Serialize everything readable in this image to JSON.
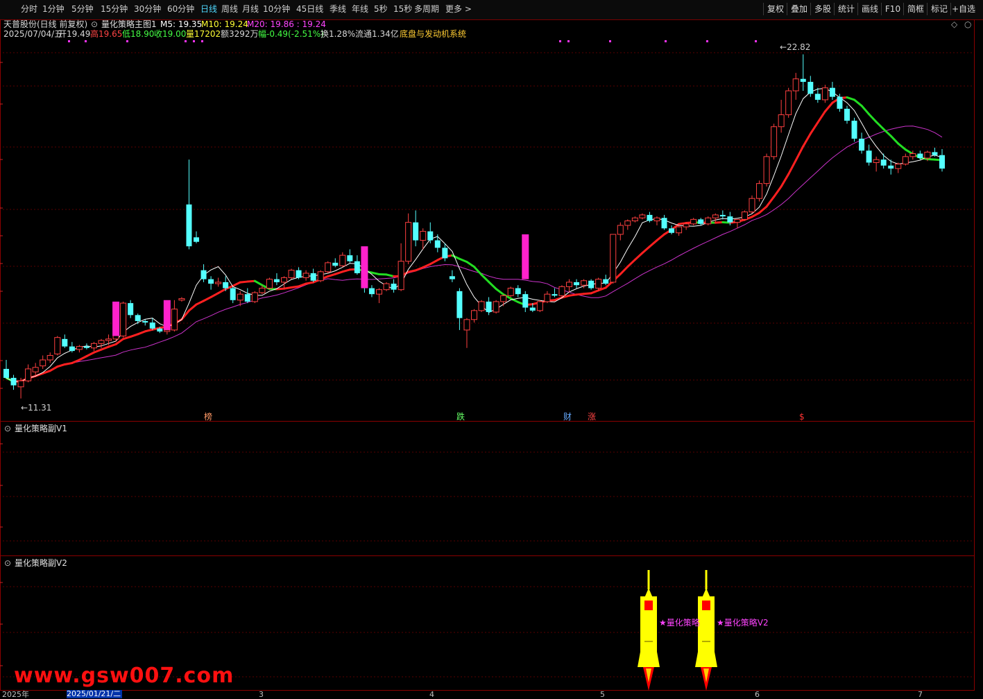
{
  "toolbar": {
    "periods": [
      "分时",
      "1分钟",
      "5分钟",
      "15分钟",
      "30分钟",
      "60分钟",
      "日线",
      "周线",
      "月线",
      "10分钟",
      "45日线",
      "季线",
      "年线",
      "5秒",
      "15秒",
      "多周期",
      "更多 >"
    ],
    "active_period": "日线",
    "buttons": [
      "复权",
      "叠加",
      "多股",
      "统计",
      "画线",
      "F10",
      "简框",
      "标记",
      "+自选"
    ]
  },
  "header": {
    "stock_name": "天普股份(日线 前复权)",
    "indicator_name": "量化策略主图1",
    "m5_label": "M5: 19.35",
    "m10_label": "M10: 19.24",
    "m20_label": "M20: 19.86 : 19.24",
    "date": "2025/07/04/五",
    "open": "开19.49",
    "high": "高19.65",
    "low": "低18.90",
    "close": "收19.00",
    "volume": "量17202",
    "amount": "额3292万",
    "change": "幅-0.49(-2.51%)",
    "turnover": "换1.28%",
    "float_cap": "流通1.34亿",
    "system_name": "底盘与发动机系统"
  },
  "price_annotations": {
    "high": "22.82",
    "low": "11.31"
  },
  "event_markers": [
    {
      "label": "榜",
      "color": "#ff9966"
    },
    {
      "label": "跌",
      "color": "#66ff66"
    },
    {
      "label": "财",
      "color": "#66aaff"
    },
    {
      "label": "涨",
      "color": "#ff4444"
    },
    {
      "label": "$",
      "color": "#ff3333"
    }
  ],
  "sub_panels": {
    "v1_title": "量化策略副V1",
    "v2_title": "量化策略副V2",
    "v2_signal_1": "★量化策略",
    "v2_signal_2": "★量化策略V2"
  },
  "date_axis": {
    "year_label": "2025年",
    "selected_date": "2025/01/21/二",
    "months": [
      "3",
      "4",
      "5",
      "6",
      "7"
    ]
  },
  "watermark": "www.gsw007.com",
  "colors": {
    "up": "#ff4040",
    "down": "#54ffff",
    "ma_red": "#ff2020",
    "ma_green": "#22dd22",
    "ma_white": "#ffffff",
    "ma_purple": "#cc33cc",
    "magenta_bar": "#ff22cc",
    "panel_border": "#8b0000",
    "signal_yellow": "#ffff00"
  },
  "chart_data": {
    "type": "candlestick",
    "ylim": [
      11.0,
      23.2
    ],
    "candles": [
      [
        12.3,
        12.6,
        12.0,
        12.0
      ],
      [
        12.0,
        12.1,
        11.6,
        11.75
      ],
      [
        11.7,
        12.0,
        11.31,
        11.9
      ],
      [
        11.9,
        12.45,
        11.85,
        12.3
      ],
      [
        12.2,
        12.5,
        12.1,
        12.35
      ],
      [
        12.4,
        12.75,
        12.3,
        12.6
      ],
      [
        12.6,
        12.85,
        12.5,
        12.75
      ],
      [
        12.8,
        13.4,
        12.75,
        13.35
      ],
      [
        13.3,
        13.45,
        13.0,
        13.05
      ],
      [
        13.05,
        13.2,
        12.85,
        12.9
      ],
      [
        12.95,
        13.1,
        12.85,
        13.05
      ],
      [
        13.05,
        13.15,
        12.95,
        13.0
      ],
      [
        13.0,
        13.2,
        12.9,
        13.15
      ],
      [
        13.15,
        13.3,
        13.0,
        13.25
      ],
      [
        13.25,
        13.45,
        13.1,
        13.3
      ],
      [
        13.3,
        13.55,
        13.2,
        13.45
      ],
      [
        13.4,
        14.55,
        13.35,
        14.5
      ],
      [
        14.5,
        14.6,
        14.0,
        14.1
      ],
      [
        14.1,
        14.15,
        13.8,
        13.9
      ],
      [
        13.9,
        13.95,
        13.75,
        13.85
      ],
      [
        13.85,
        14.0,
        13.6,
        13.65
      ],
      [
        13.65,
        13.7,
        13.5,
        13.55
      ],
      [
        13.55,
        13.7,
        13.45,
        13.6
      ],
      [
        13.6,
        14.6,
        13.55,
        14.3
      ],
      [
        14.6,
        14.7,
        14.55,
        14.65
      ],
      [
        17.8,
        19.3,
        16.3,
        16.4
      ],
      [
        16.7,
        16.9,
        16.5,
        16.55
      ],
      [
        15.6,
        15.8,
        15.2,
        15.3
      ],
      [
        15.3,
        15.4,
        14.95,
        15.15
      ],
      [
        15.15,
        15.35,
        15.05,
        15.2
      ],
      [
        15.2,
        15.4,
        14.9,
        15.0
      ],
      [
        15.0,
        15.05,
        14.5,
        14.6
      ],
      [
        14.6,
        14.9,
        14.4,
        14.8
      ],
      [
        14.8,
        15.0,
        14.5,
        14.55
      ],
      [
        14.55,
        14.9,
        14.5,
        14.85
      ],
      [
        14.85,
        15.1,
        14.8,
        15.0
      ],
      [
        15.0,
        15.35,
        14.95,
        15.3
      ],
      [
        15.3,
        15.5,
        15.1,
        15.2
      ],
      [
        15.2,
        15.4,
        15.0,
        15.35
      ],
      [
        15.35,
        15.65,
        15.3,
        15.6
      ],
      [
        15.6,
        15.7,
        15.3,
        15.35
      ],
      [
        15.35,
        15.6,
        15.25,
        15.5
      ],
      [
        15.5,
        15.65,
        15.2,
        15.25
      ],
      [
        15.25,
        15.6,
        15.2,
        15.55
      ],
      [
        15.55,
        15.9,
        15.5,
        15.85
      ],
      [
        15.85,
        16.0,
        15.7,
        15.75
      ],
      [
        15.75,
        16.2,
        15.7,
        16.1
      ],
      [
        16.1,
        16.3,
        15.85,
        15.9
      ],
      [
        15.9,
        16.1,
        15.45,
        15.5
      ],
      [
        15.5,
        15.6,
        14.85,
        15.0
      ],
      [
        15.0,
        15.1,
        14.7,
        14.8
      ],
      [
        14.8,
        15.0,
        14.5,
        14.95
      ],
      [
        14.95,
        15.2,
        14.9,
        15.15
      ],
      [
        15.15,
        15.3,
        14.85,
        14.95
      ],
      [
        14.95,
        16.5,
        14.9,
        15.9
      ],
      [
        15.9,
        17.5,
        15.8,
        17.2
      ],
      [
        17.2,
        17.6,
        16.4,
        16.6
      ],
      [
        16.6,
        17.0,
        16.3,
        16.9
      ],
      [
        16.9,
        17.2,
        16.5,
        16.6
      ],
      [
        16.6,
        16.8,
        16.2,
        16.35
      ],
      [
        16.35,
        16.5,
        15.9,
        16.0
      ],
      [
        15.4,
        15.6,
        15.2,
        15.3
      ],
      [
        14.9,
        15.0,
        13.6,
        14.0
      ],
      [
        13.6,
        14.0,
        13.0,
        13.95
      ],
      [
        13.95,
        14.3,
        13.85,
        14.25
      ],
      [
        14.25,
        14.6,
        14.2,
        14.55
      ],
      [
        14.55,
        14.7,
        14.1,
        14.2
      ],
      [
        14.2,
        14.6,
        14.15,
        14.55
      ],
      [
        14.55,
        14.8,
        14.4,
        14.75
      ],
      [
        14.75,
        15.05,
        14.7,
        15.0
      ],
      [
        15.0,
        15.1,
        14.7,
        14.8
      ],
      [
        14.8,
        14.9,
        14.2,
        14.35
      ],
      [
        14.35,
        14.5,
        14.2,
        14.25
      ],
      [
        14.25,
        14.6,
        14.2,
        14.55
      ],
      [
        14.55,
        14.9,
        14.5,
        14.8
      ],
      [
        14.8,
        15.0,
        14.7,
        14.75
      ],
      [
        14.75,
        15.1,
        14.7,
        15.05
      ],
      [
        15.05,
        15.3,
        14.85,
        15.2
      ],
      [
        15.2,
        15.3,
        15.0,
        15.1
      ],
      [
        15.1,
        15.3,
        15.0,
        15.25
      ],
      [
        15.25,
        15.3,
        14.95,
        15.0
      ],
      [
        15.0,
        15.35,
        14.9,
        15.3
      ],
      [
        15.3,
        15.45,
        15.1,
        15.15
      ],
      [
        15.2,
        16.8,
        15.15,
        16.8
      ],
      [
        16.8,
        17.2,
        16.6,
        17.1
      ],
      [
        17.1,
        17.3,
        16.95,
        17.25
      ],
      [
        17.25,
        17.4,
        17.2,
        17.35
      ],
      [
        17.35,
        17.5,
        17.3,
        17.45
      ],
      [
        17.45,
        17.55,
        17.2,
        17.25
      ],
      [
        17.25,
        17.4,
        17.1,
        17.35
      ],
      [
        17.35,
        17.45,
        16.95,
        17.0
      ],
      [
        17.0,
        17.1,
        16.8,
        16.85
      ],
      [
        16.85,
        17.1,
        16.75,
        17.05
      ],
      [
        17.05,
        17.2,
        16.95,
        17.15
      ],
      [
        17.15,
        17.35,
        17.1,
        17.3
      ],
      [
        17.3,
        17.35,
        17.1,
        17.15
      ],
      [
        17.15,
        17.4,
        17.1,
        17.35
      ],
      [
        17.35,
        17.5,
        17.2,
        17.45
      ],
      [
        17.45,
        17.6,
        17.3,
        17.4
      ],
      [
        17.4,
        17.55,
        17.1,
        17.2
      ],
      [
        17.2,
        17.3,
        17.0,
        17.3
      ],
      [
        17.3,
        17.6,
        17.25,
        17.55
      ],
      [
        17.55,
        18.1,
        17.5,
        18.0
      ],
      [
        18.0,
        18.6,
        17.9,
        18.5
      ],
      [
        18.5,
        19.5,
        18.4,
        19.4
      ],
      [
        19.4,
        20.5,
        19.3,
        20.4
      ],
      [
        20.4,
        21.3,
        20.2,
        20.8
      ],
      [
        20.8,
        21.7,
        20.7,
        21.6
      ],
      [
        21.6,
        22.2,
        21.3,
        22.0
      ],
      [
        22.0,
        22.82,
        21.6,
        21.9
      ],
      [
        21.9,
        22.1,
        21.4,
        21.5
      ],
      [
        21.5,
        21.7,
        21.2,
        21.3
      ],
      [
        21.3,
        21.8,
        21.2,
        21.7
      ],
      [
        21.7,
        21.9,
        21.3,
        21.4
      ],
      [
        21.4,
        21.5,
        20.9,
        21.0
      ],
      [
        21.0,
        21.1,
        20.5,
        20.6
      ],
      [
        20.6,
        20.7,
        19.9,
        20.0
      ],
      [
        20.0,
        20.2,
        19.5,
        19.6
      ],
      [
        19.6,
        19.8,
        19.1,
        19.2
      ],
      [
        19.2,
        19.4,
        18.9,
        19.3
      ],
      [
        19.3,
        19.5,
        19.0,
        19.1
      ],
      [
        19.1,
        19.3,
        18.8,
        19.0
      ],
      [
        19.0,
        19.2,
        18.85,
        19.15
      ],
      [
        19.15,
        19.5,
        19.1,
        19.4
      ],
      [
        19.4,
        19.6,
        19.3,
        19.5
      ],
      [
        19.5,
        19.6,
        19.3,
        19.35
      ],
      [
        19.35,
        19.6,
        19.25,
        19.55
      ],
      [
        19.55,
        19.7,
        19.4,
        19.45
      ],
      [
        19.45,
        19.65,
        18.9,
        19.0
      ]
    ],
    "magenta_bars": [
      {
        "index": 15,
        "from": 13.4,
        "to": 14.55
      },
      {
        "index": 22,
        "from": 13.6,
        "to": 14.6
      },
      {
        "index": 49,
        "from": 15.0,
        "to": 16.4
      },
      {
        "index": 71,
        "from": 15.3,
        "to": 16.8
      }
    ]
  }
}
